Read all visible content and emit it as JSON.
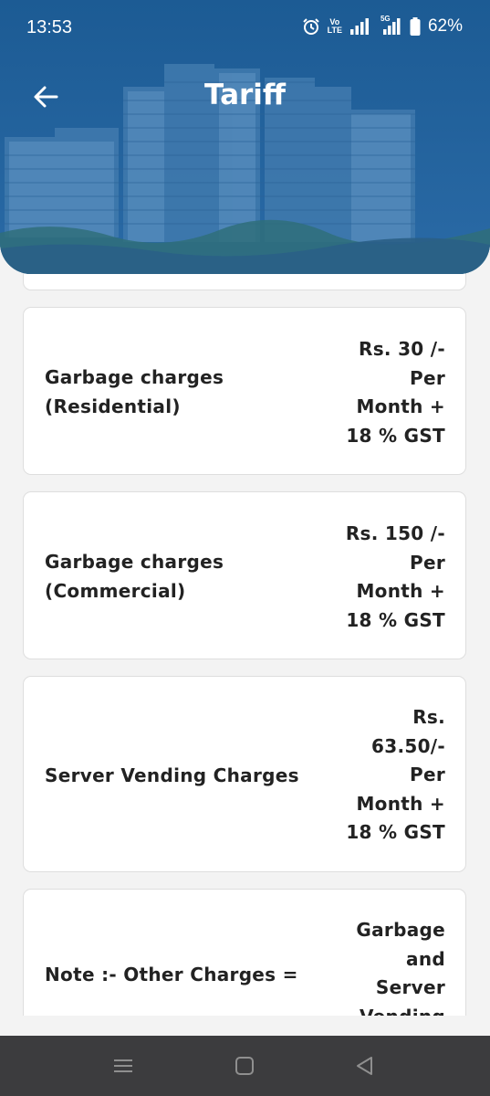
{
  "status_bar": {
    "time": "13:53",
    "volte_top": "Vo",
    "volte_bottom": "LTE",
    "network": "5G",
    "battery": "62%",
    "icons": [
      "alarm-icon",
      "volte-icon",
      "signal-icon",
      "5g-signal-icon",
      "battery-icon"
    ]
  },
  "header": {
    "title": "Tariff",
    "back_icon": "arrow-left-icon",
    "background_color": "#1f5f98"
  },
  "cards": [
    {
      "label": "Garbage charges\n(Residential)",
      "value": "Rs. 30 /-\nPer\nMonth +\n18 % GST"
    },
    {
      "label": "Garbage charges\n(Commercial)",
      "value": "Rs. 150 /-\nPer\nMonth +\n18 % GST"
    },
    {
      "label": "Server Vending Charges",
      "value": "Rs.\n63.50/-\nPer\nMonth +\n18 % GST"
    },
    {
      "label": "Note :- Other Charges =",
      "value": "Garbage\nand\nServer\nVending"
    }
  ],
  "navbar": {
    "icons": [
      "recent-apps-icon",
      "home-icon",
      "back-triangle-icon"
    ]
  }
}
